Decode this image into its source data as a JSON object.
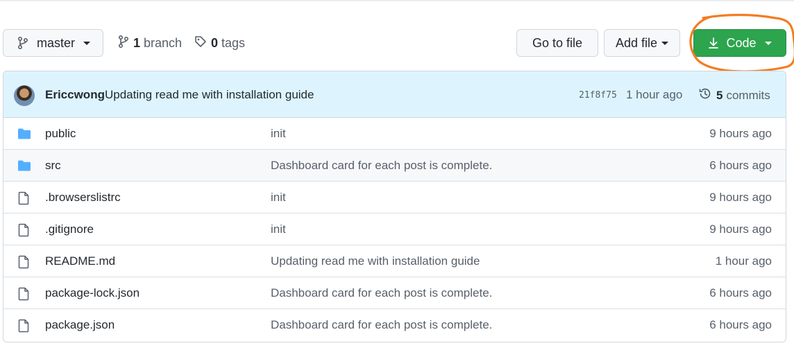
{
  "toolbar": {
    "branch_label": "master",
    "branch_count": "1",
    "branch_word": "branch",
    "tag_count": "0",
    "tag_word": "tags",
    "goto_label": "Go to file",
    "addfile_label": "Add file",
    "code_label": "Code"
  },
  "colors": {
    "code_button": "#2da44e",
    "commit_bar": "#ddf4ff",
    "annotation": "#f47c20",
    "folder": "#54aeff"
  },
  "commit": {
    "author": "Ericcwong",
    "message": "Updating read me with installation guide",
    "sha": "21f8f75",
    "time": "1 hour ago",
    "commit_count": "5",
    "commit_word": "commits"
  },
  "files": [
    {
      "type": "folder",
      "name": "public",
      "message": "init",
      "time": "9 hours ago"
    },
    {
      "type": "folder",
      "name": "src",
      "message": "Dashboard card for each post is complete.",
      "time": "6 hours ago"
    },
    {
      "type": "file",
      "name": ".browserslistrc",
      "message": "init",
      "time": "9 hours ago"
    },
    {
      "type": "file",
      "name": ".gitignore",
      "message": "init",
      "time": "9 hours ago"
    },
    {
      "type": "file",
      "name": "README.md",
      "message": "Updating read me with installation guide",
      "time": "1 hour ago"
    },
    {
      "type": "file",
      "name": "package-lock.json",
      "message": "Dashboard card for each post is complete.",
      "time": "6 hours ago"
    },
    {
      "type": "file",
      "name": "package.json",
      "message": "Dashboard card for each post is complete.",
      "time": "6 hours ago"
    }
  ]
}
